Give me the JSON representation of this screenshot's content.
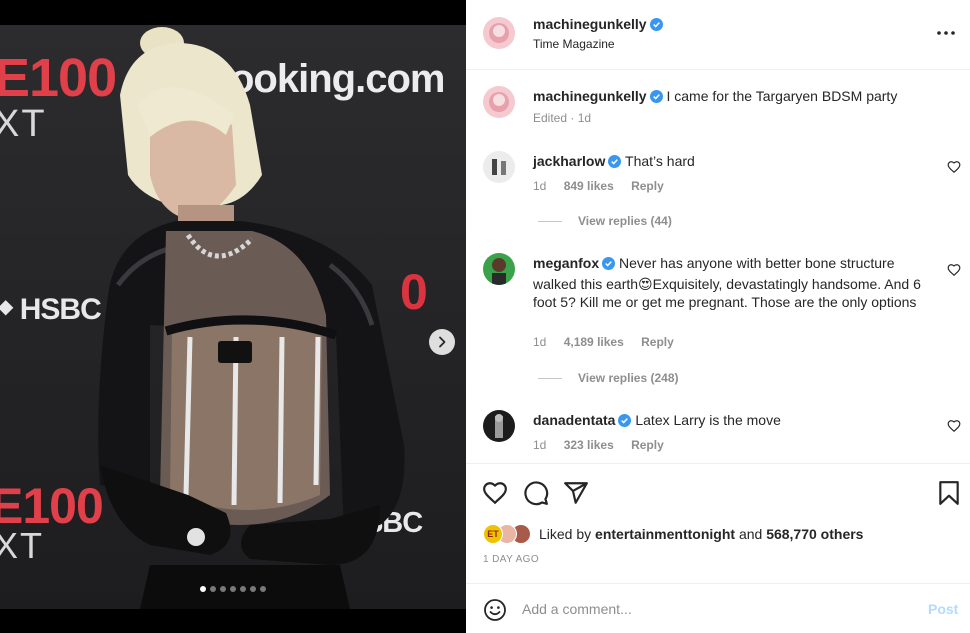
{
  "photo": {
    "wall_text": {
      "time100_a": "E100",
      "ext_a": "XT",
      "booking": "ooking.com",
      "hsbc_a": "HSBC",
      "red_fragment": "0",
      "time100_b": "E100",
      "ext_b": "XT",
      "hsbc_b": "HSBC"
    },
    "carousel": {
      "total": 7,
      "active_index": 0
    }
  },
  "header": {
    "username": "machinegunkelly",
    "location": "Time Magazine"
  },
  "caption": {
    "username": "machinegunkelly",
    "text": "I came for the Targaryen BDSM party",
    "meta": "Edited · 1d"
  },
  "comments": [
    {
      "username": "jackharlow",
      "text": "That’s hard",
      "age": "1d",
      "likes": "849 likes",
      "reply": "Reply",
      "view_replies": "View replies (44)"
    },
    {
      "username": "meganfox",
      "text": "Never has anyone with better bone structure walked this earth😍Exquisitely, devastatingly handsome. And 6 foot 5? Kill me or get me pregnant. Those are the only options",
      "age": "1d",
      "likes": "4,189 likes",
      "reply": "Reply",
      "view_replies": "View replies (248)"
    },
    {
      "username": "danadentata",
      "text": "Latex Larry is the move",
      "age": "1d",
      "likes": "323 likes",
      "reply": "Reply"
    }
  ],
  "likes": {
    "prefix": "Liked by",
    "top_liker": "entertainmenttonight",
    "middle": "and",
    "others": "568,770 others",
    "avatar_badge": "ET"
  },
  "timestamp": "1 DAY AGO",
  "composer": {
    "placeholder": "Add a comment...",
    "post_label": "Post"
  },
  "colors": {
    "verified": "#3897f0",
    "post_disabled": "#b3dbff",
    "muted": "#8e8e8e"
  },
  "icons": [
    "more-icon",
    "verified-icon",
    "heart-icon",
    "comment-icon",
    "share-icon",
    "bookmark-icon",
    "emoji-icon",
    "chevron-right-icon"
  ]
}
